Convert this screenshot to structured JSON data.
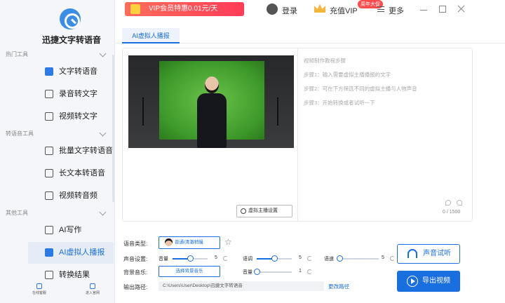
{
  "app": {
    "name": "迅捷文字转语音"
  },
  "sidebar": {
    "groups": [
      {
        "label": "热门工具"
      },
      {
        "label": "转语音工具"
      },
      {
        "label": "其他工具"
      }
    ],
    "items": [
      {
        "label": "文字转语音",
        "icon": "text-to-speech-icon"
      },
      {
        "label": "录音转文字",
        "icon": "recording-icon"
      },
      {
        "label": "视频转文字",
        "icon": "video-icon"
      },
      {
        "label": "批量文字转语音",
        "icon": "batch-icon"
      },
      {
        "label": "长文本转语音",
        "icon": "document-icon"
      },
      {
        "label": "视频转音频",
        "icon": "video-audio-icon"
      },
      {
        "label": "AI写作",
        "icon": "ai-write-icon"
      },
      {
        "label": "AI虚拟人播报",
        "icon": "virtual-anchor-icon",
        "active": true
      },
      {
        "label": "转换结果",
        "icon": "result-icon"
      }
    ],
    "bottom": [
      {
        "label": "在线客服",
        "icon": "support-icon"
      },
      {
        "label": "进入官网",
        "icon": "website-icon"
      }
    ]
  },
  "topbar": {
    "vip_banner": "VIP会员特惠0.01元/天",
    "login": "登录",
    "recharge_vip": "充值VIP",
    "badge": "周年大促",
    "more": "更多"
  },
  "tab": {
    "label": "AI虚拟人播报"
  },
  "video": {
    "anchor_settings": "虚拟主播设置"
  },
  "script": {
    "title": "视频制作教程步骤",
    "steps": [
      "步骤1：输入需要虚拟主播播报的文字",
      "步骤2：可在下方筛选不同的虚拟主播与人物声音",
      "步骤3：开始转换或者试听一下"
    ],
    "char_count": "0 / 1500"
  },
  "controls": {
    "voice_type_label": "语音类型:",
    "voice_name": "普通/清澈稍慢",
    "sound_settings_label": "声音设置:",
    "volume_label": "音量",
    "volume_value": "5",
    "volume_level": 0.5,
    "pitch_label": "语调",
    "pitch_value": "5",
    "pitch_level": 0.5,
    "speed_label": "语速",
    "speed_value": "5",
    "speed_level": 0.0,
    "bg_music_label": "背景音乐:",
    "bg_music_button": "选择背景音乐",
    "bg_volume_label": "音量",
    "bg_volume_value": "1",
    "bg_volume_level": 0.0,
    "output_path_label": "输出路径:",
    "output_path": "C:\\Users\\User\\Desktop\\迅捷文字转语音",
    "change_path": "更改路径",
    "try_listen": "声音试听",
    "export_video": "导出视频"
  },
  "colors": {
    "accent": "#1a6fe0",
    "banner": "#ff3c57"
  }
}
